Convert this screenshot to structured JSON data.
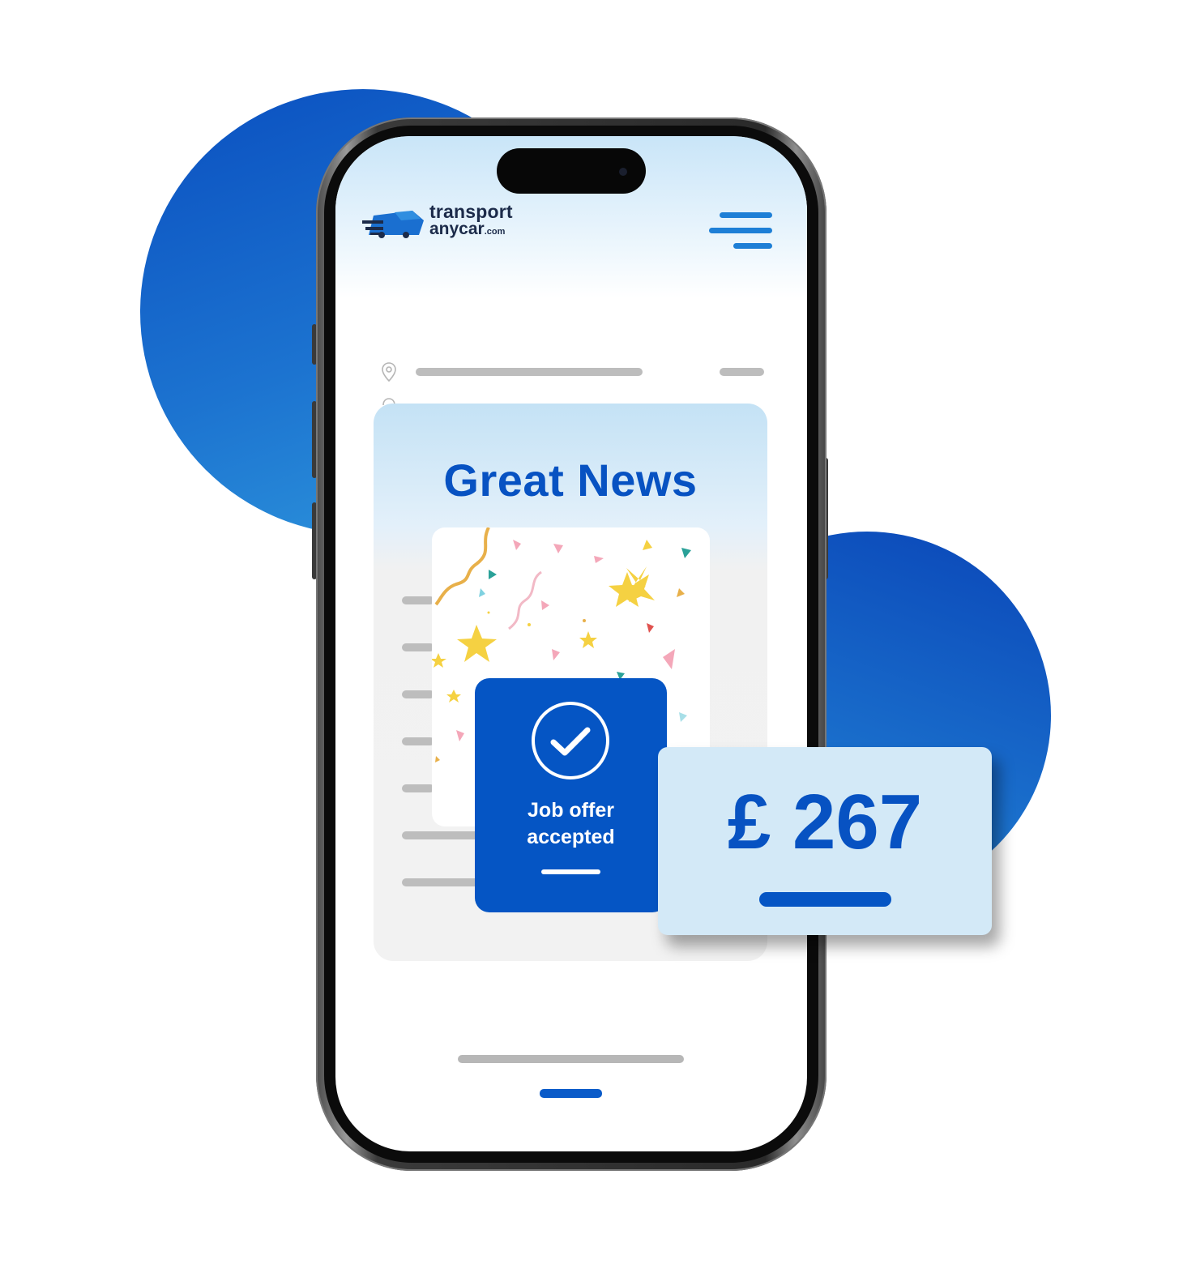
{
  "colors": {
    "brand_blue": "#0752c2",
    "accent_blue": "#1e7fd6",
    "card_light": "#d3e9f7",
    "placeholder_gray": "#bdbdbd"
  },
  "logo": {
    "line1": "transport",
    "line2": "anycar",
    "suffix": ".com"
  },
  "header": {
    "menu_icon": "hamburger-menu-icon"
  },
  "card": {
    "title": "Great News"
  },
  "job_card": {
    "icon": "check-circle-icon",
    "label_line1": "Job offer",
    "label_line2": "accepted"
  },
  "price_card": {
    "amount": "£ 267"
  }
}
